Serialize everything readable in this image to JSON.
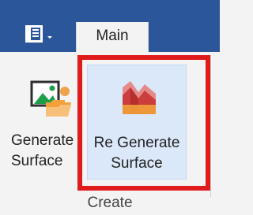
{
  "tabs": [
    {
      "label": "Main",
      "selected": true
    }
  ],
  "ribbon": {
    "group_label": "Create",
    "buttons": [
      {
        "label": "Generate\nSurface",
        "icon": "generate-surface-icon"
      },
      {
        "label": "Re Generate\nSurface",
        "icon": "regenerate-surface-icon",
        "highlighted": true
      }
    ]
  },
  "app_menu_icon": "document-menu-icon",
  "colors": {
    "titlebar": "#2b579a",
    "ribbon_bg": "#f3f3f3",
    "highlight": "#e01b1b",
    "hover_bg": "#dbe8fa"
  }
}
